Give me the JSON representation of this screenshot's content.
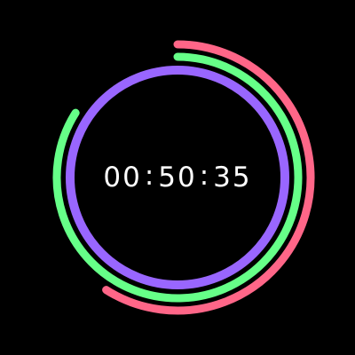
{
  "timer": {
    "hours": "00",
    "minutes": "50",
    "seconds": "35",
    "separator": ":"
  },
  "rings": {
    "seconds_ring": {
      "color": "#9966ff",
      "fraction": 1.0
    },
    "minutes_ring": {
      "color": "#66ff88",
      "fraction": 0.84
    },
    "hours_ring": {
      "color": "#ff6688",
      "fraction": 0.59
    }
  }
}
